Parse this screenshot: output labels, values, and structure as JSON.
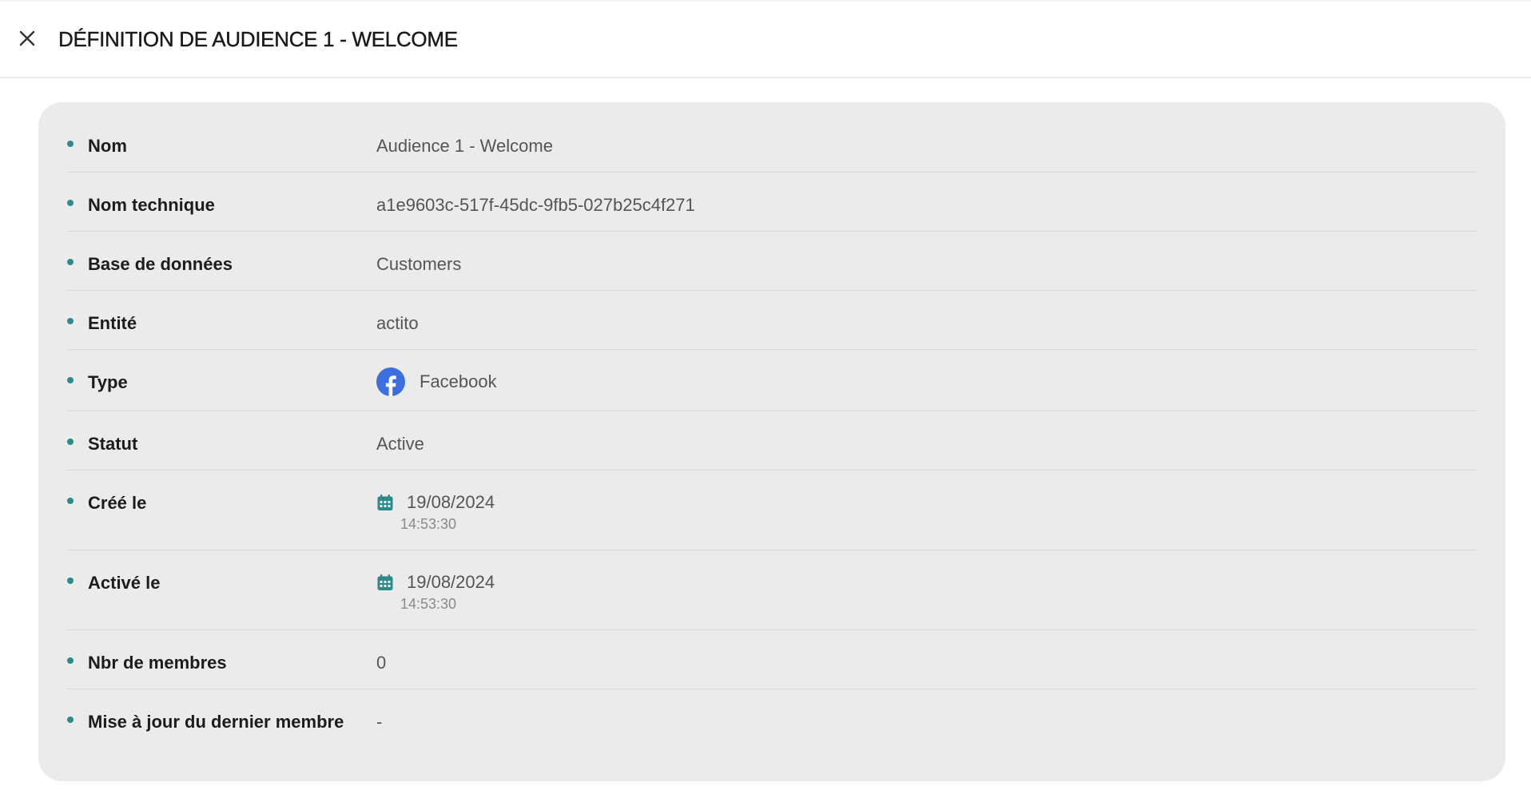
{
  "header": {
    "title": "DÉFINITION DE AUDIENCE 1 - WELCOME",
    "close_icon": "close-icon"
  },
  "colors": {
    "accent": "#2e8a8a",
    "facebook": "#3b6fe0",
    "card_bg": "#ebebeb"
  },
  "details": {
    "name": {
      "label": "Nom",
      "value": "Audience 1 - Welcome"
    },
    "technical_name": {
      "label": "Nom technique",
      "value": "a1e9603c-517f-45dc-9fb5-027b25c4f271"
    },
    "database": {
      "label": "Base de données",
      "value": "Customers"
    },
    "entity": {
      "label": "Entité",
      "value": "actito"
    },
    "type": {
      "label": "Type",
      "value": "Facebook",
      "icon": "facebook-icon"
    },
    "status": {
      "label": "Statut",
      "value": "Active"
    },
    "created": {
      "label": "Créé le",
      "date": "19/08/2024",
      "time": "14:53:30",
      "icon": "calendar-icon"
    },
    "activated": {
      "label": "Activé le",
      "date": "19/08/2024",
      "time": "14:53:30",
      "icon": "calendar-icon"
    },
    "member_count": {
      "label": "Nbr de membres",
      "value": "0"
    },
    "last_member_update": {
      "label": "Mise à jour du dernier membre",
      "value": "-"
    }
  }
}
